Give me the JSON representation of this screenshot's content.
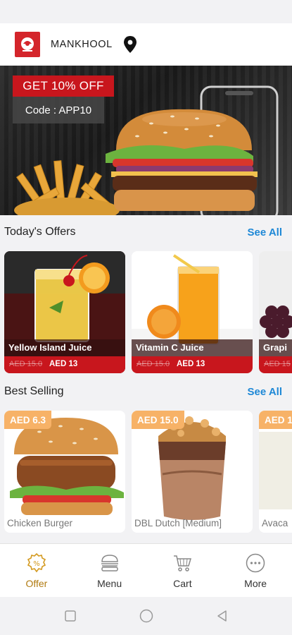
{
  "header": {
    "brand": "MANKHOOL",
    "logo_icon": "restaurant-logo-icon",
    "location_icon": "location-pin-icon"
  },
  "banner": {
    "promo_title": "GET 10% OFF",
    "promo_code": "Code : APP10"
  },
  "offers": {
    "title": "Today's Offers",
    "see_all": "See All",
    "items": [
      {
        "name": "Yellow Island Juice",
        "old_price": "AED 15.0",
        "new_price": "AED 13"
      },
      {
        "name": "Vitamin C Juice",
        "old_price": "AED 15.0",
        "new_price": "AED 13"
      },
      {
        "name": "Grapi",
        "old_price": "AED 15",
        "new_price": ""
      }
    ]
  },
  "best_selling": {
    "title": "Best Selling",
    "see_all": "See All",
    "items": [
      {
        "name": "Chicken Burger",
        "price": "AED 6.3"
      },
      {
        "name": "DBL Dutch [Medium]",
        "price": "AED 15.0"
      },
      {
        "name": "Avaca",
        "price": "AED 1"
      }
    ]
  },
  "bottom_nav": [
    {
      "label": "Offer",
      "icon": "offer-badge-icon",
      "active": true
    },
    {
      "label": "Menu",
      "icon": "burger-icon",
      "active": false
    },
    {
      "label": "Cart",
      "icon": "cart-icon",
      "active": false
    },
    {
      "label": "More",
      "icon": "more-dots-icon",
      "active": false
    }
  ],
  "colors": {
    "accent_red": "#c8161d",
    "link_blue": "#1e88d6",
    "price_tag": "#f7b267",
    "active_nav": "#b07a10"
  }
}
